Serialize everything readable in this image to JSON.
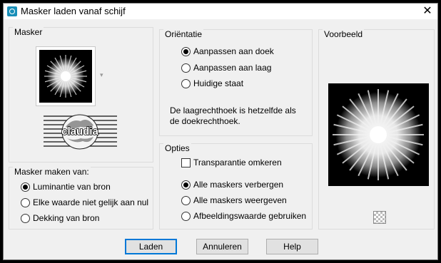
{
  "window": {
    "title": "Masker laden vanaf schijf"
  },
  "mask": {
    "title": "Masker",
    "icon": "mask-starburst-thumbnail",
    "logo_text": "claudia"
  },
  "orientation": {
    "title": "Oriëntatie",
    "options": [
      "Aanpassen aan doek",
      "Aanpassen aan laag",
      "Huidige staat"
    ],
    "selected": 0,
    "note_line1": "De laagrechthoek is hetzelfde als",
    "note_line2": "de doekrechthoek."
  },
  "preview": {
    "title": "Voorbeeld",
    "icon": "transparency-checker-icon"
  },
  "source": {
    "title": "Masker maken van:",
    "options": [
      "Luminantie van bron",
      "Elke waarde niet gelijk aan nul",
      "Dekking van bron"
    ],
    "selected": 0
  },
  "options": {
    "title": "Opties",
    "invert_label": "Transparantie omkeren",
    "invert_checked": false,
    "radios": [
      "Alle maskers verbergen",
      "Alle maskers weergeven",
      "Afbeeldingswaarde gebruiken"
    ],
    "selected": 0
  },
  "buttons": {
    "load": "Laden",
    "cancel": "Annuleren",
    "help": "Help"
  },
  "colors": {
    "accent": "#0078d7",
    "window_bg": "#f0f0f0",
    "frame": "#000000"
  }
}
